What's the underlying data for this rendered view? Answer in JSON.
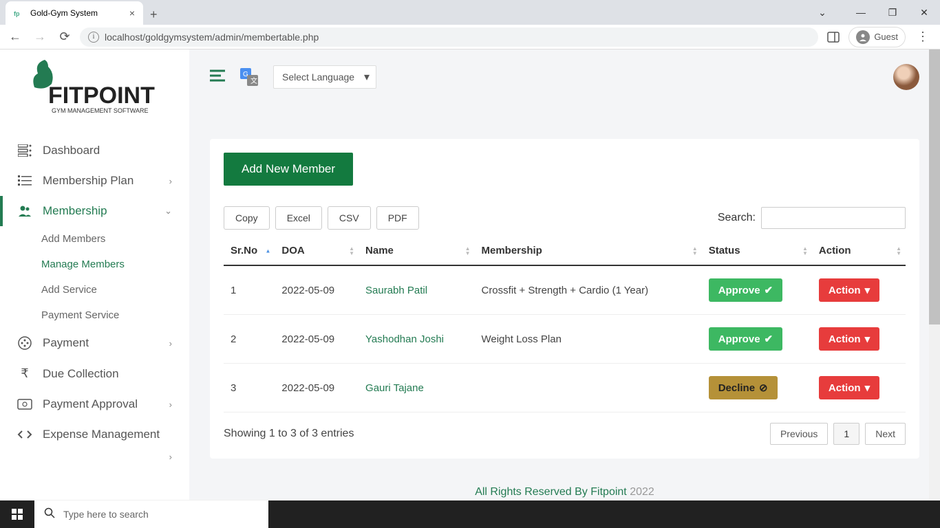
{
  "browser": {
    "tab_title": "Gold-Gym System",
    "url": "localhost/goldgymsystem/admin/membertable.php",
    "profile_label": "Guest"
  },
  "sidebar": {
    "logo_text": "FITPOINT",
    "logo_sub": "GYM MANAGEMENT SOFTWARE",
    "items": [
      {
        "label": "Dashboard",
        "icon": "dashboard-icon"
      },
      {
        "label": "Membership Plan",
        "icon": "list-icon",
        "chev": true
      },
      {
        "label": "Membership",
        "icon": "users-icon",
        "chev": true,
        "active": true
      },
      {
        "label": "Payment",
        "icon": "coin-icon",
        "chev": true
      },
      {
        "label": "Due Collection",
        "icon": "rupee-icon"
      },
      {
        "label": "Payment Approval",
        "icon": "money-icon",
        "chev": true
      },
      {
        "label": "Expense Management",
        "icon": "code-icon",
        "chev": true
      }
    ],
    "submenu": [
      {
        "label": "Add Members"
      },
      {
        "label": "Manage Members",
        "active": true
      },
      {
        "label": "Add Service"
      },
      {
        "label": "Payment Service"
      }
    ]
  },
  "topbar": {
    "lang_select": "Select Language"
  },
  "content": {
    "add_button": "Add New Member",
    "export": {
      "copy": "Copy",
      "excel": "Excel",
      "csv": "CSV",
      "pdf": "PDF"
    },
    "search_label": "Search:",
    "headers": {
      "srno": "Sr.No",
      "doa": "DOA",
      "name": "Name",
      "membership": "Membership",
      "status": "Status",
      "action": "Action"
    },
    "rows": [
      {
        "srno": "1",
        "doa": "2022-05-09",
        "name": "Saurabh Patil",
        "membership": "Crossfit + Strength + Cardio (1 Year)",
        "status": "Approve",
        "status_type": "approve",
        "action": "Action"
      },
      {
        "srno": "2",
        "doa": "2022-05-09",
        "name": "Yashodhan Joshi",
        "membership": "Weight Loss Plan",
        "status": "Approve",
        "status_type": "approve",
        "action": "Action"
      },
      {
        "srno": "3",
        "doa": "2022-05-09",
        "name": "Gauri Tajane",
        "membership": "",
        "status": "Decline",
        "status_type": "decline",
        "action": "Action"
      }
    ],
    "showing_text": "Showing 1 to 3 of 3 entries",
    "pagination": {
      "prev": "Previous",
      "page": "1",
      "next": "Next"
    }
  },
  "footer": {
    "text": "All Rights Reserved By Fitpoint",
    "year": "2022"
  },
  "taskbar": {
    "search_ph": "Type here to search"
  }
}
